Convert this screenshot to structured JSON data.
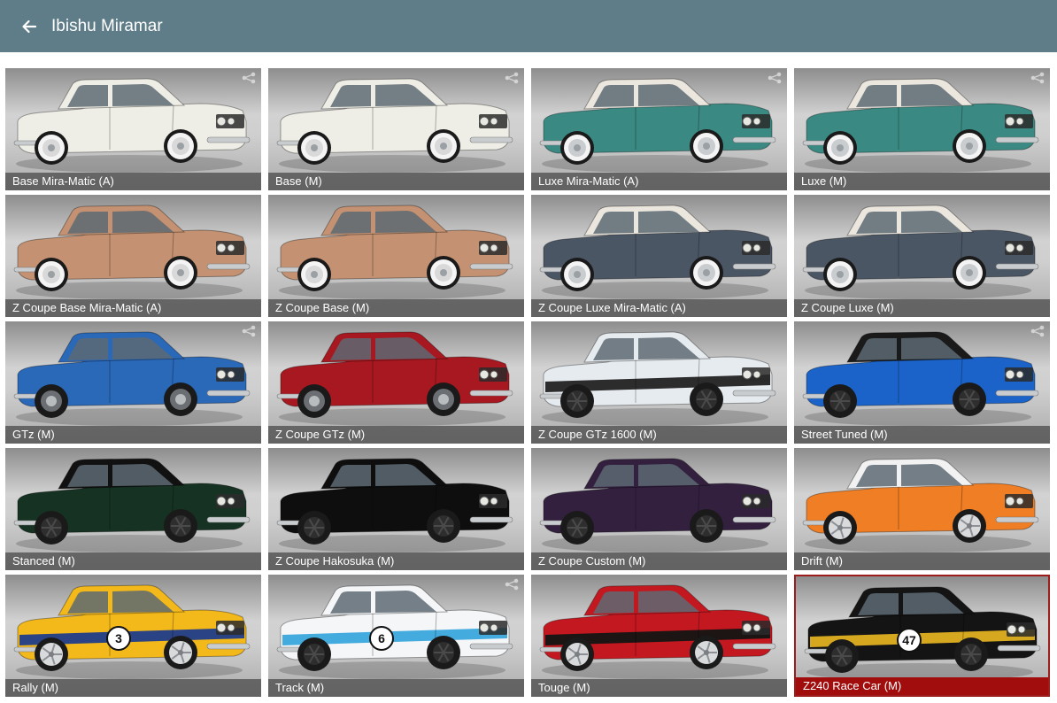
{
  "header": {
    "title": "Ibishu Miramar",
    "back_icon": "arrow-left-icon",
    "background": "#5f7c89"
  },
  "accent_selected": "#a10d0d",
  "configs": [
    {
      "label": "Base Mira-Matic (A)",
      "body": "#efeee6",
      "roof": "#efeee6",
      "wheel": "whitewall-steel",
      "share": true
    },
    {
      "label": "Base (M)",
      "body": "#efeee6",
      "roof": "#efeee6",
      "wheel": "whitewall-steel",
      "share": true
    },
    {
      "label": "Luxe Mira-Matic (A)",
      "body": "#3a8a83",
      "roof": "#ece7de",
      "wheel": "whitewall",
      "share": true
    },
    {
      "label": "Luxe (M)",
      "body": "#3a8a83",
      "roof": "#ece7de",
      "wheel": "whitewall",
      "share": true
    },
    {
      "label": "Z Coupe Base Mira-Matic (A)",
      "body": "#c49272",
      "roof": "#c49272",
      "wheel": "whitewall-steel",
      "share": false
    },
    {
      "label": "Z Coupe Base (M)",
      "body": "#c49272",
      "roof": "#c49272",
      "wheel": "whitewall-steel",
      "share": false
    },
    {
      "label": "Z Coupe Luxe Mira-Matic (A)",
      "body": "#4b5665",
      "roof": "#ece7de",
      "wheel": "whitewall",
      "share": false
    },
    {
      "label": "Z Coupe Luxe (M)",
      "body": "#4b5665",
      "roof": "#ece7de",
      "wheel": "whitewall",
      "share": false
    },
    {
      "label": "GTz (M)",
      "body": "#2a68b8",
      "roof": "#2a68b8",
      "wheel": "steel",
      "share": true
    },
    {
      "label": "Z Coupe GTz (M)",
      "body": "#a81820",
      "roof": "#a81820",
      "wheel": "steel",
      "share": false
    },
    {
      "label": "Z Coupe GTz 1600 (M)",
      "body": "#e6ebef",
      "roof": "#e6ebef",
      "wheel": "black",
      "stripe": "#222222",
      "share": false
    },
    {
      "label": "Street Tuned (M)",
      "body": "#1b63c8",
      "roof": "#1a1a1a",
      "wheel": "black",
      "share": true
    },
    {
      "label": "Stanced (M)",
      "body": "#163222",
      "roof": "#111111",
      "wheel": "black",
      "share": false
    },
    {
      "label": "Z Coupe Hakosuka (M)",
      "body": "#0e0e0e",
      "roof": "#0e0e0e",
      "wheel": "black",
      "share": false
    },
    {
      "label": "Z Coupe Custom (M)",
      "body": "#33203f",
      "roof": "#33203f",
      "wheel": "black",
      "share": false
    },
    {
      "label": "Drift (M)",
      "body": "#f07e24",
      "roof": "#f2f2f2",
      "wheel": "silver",
      "share": false
    },
    {
      "label": "Rally (M)",
      "body": "#f3b81a",
      "roof": "#f3b81a",
      "wheel": "silver",
      "stripe": "#1f3c8a",
      "number": "3",
      "share": false
    },
    {
      "label": "Track (M)",
      "body": "#f4f6f8",
      "roof": "#f4f6f8",
      "wheel": "black",
      "stripe": "#3aa7dd",
      "number": "6",
      "share": true
    },
    {
      "label": "Touge (M)",
      "body": "#c31820",
      "roof": "#c31820",
      "wheel": "silver",
      "stripe": "#141414",
      "share": false
    },
    {
      "label": "Z240 Race Car (M)",
      "body": "#141414",
      "roof": "#141414",
      "wheel": "black",
      "stripe": "#e0b020",
      "number": "47",
      "share": false,
      "selected": true
    }
  ]
}
